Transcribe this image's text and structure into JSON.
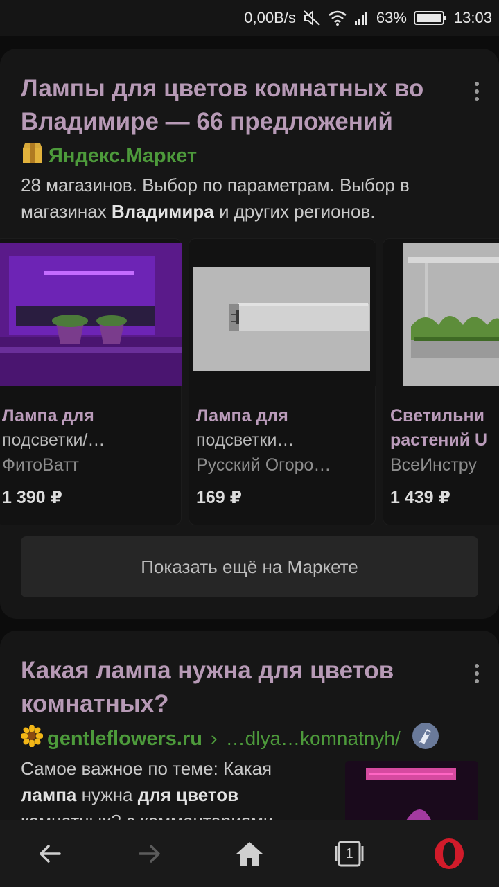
{
  "status_bar": {
    "net_speed": "0,00B/s",
    "battery": "63%",
    "time": "13:03"
  },
  "result1": {
    "title": "Лампы для цветов комнатных во Владимире — 66 предложений",
    "source": "Яндекс.Маркет",
    "snippet_part1": "28 магазинов. Выбор по параметрам. Выбор в магазинах ",
    "snippet_bold": "Владимира",
    "snippet_part2": " и других регионов.",
    "products": [
      {
        "title": "Лампа для",
        "subtitle": "подсветки/…",
        "shop": "ФитоВатт",
        "price": "1 390 ₽"
      },
      {
        "title": "Лампа для",
        "subtitle": "подсветки…",
        "shop": "Русский Огоро…",
        "price": "169 ₽"
      },
      {
        "title": "Светильни",
        "subtitle": "растений U",
        "shop": "ВсеИнстру",
        "price": "1 439 ₽"
      }
    ],
    "more_button": "Показать ещё на Маркете"
  },
  "result2": {
    "title": "Какая лампа нужна для цветов комнатных?",
    "source": "gentleflowers.ru",
    "separator": "›",
    "path": "…dlya…komnatnyh/",
    "snippet_part1": "Самое важное по теме: Какая ",
    "snippet_bold1": "лампа",
    "snippet_part2": " нужна ",
    "snippet_bold2": "для цветов",
    "snippet_part3": "комнатных? с комментариями"
  },
  "bottom_nav": {
    "tab_count": "1"
  },
  "colors": {
    "title": "#b79ab6",
    "source": "#4d9a3b",
    "background": "#0c0c0c",
    "card": "#161616"
  }
}
